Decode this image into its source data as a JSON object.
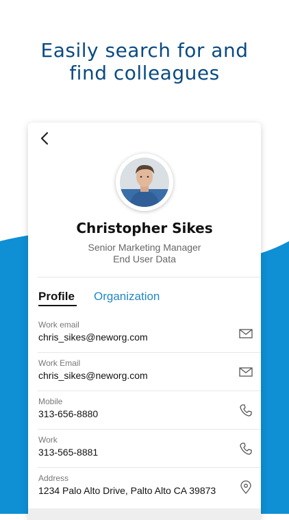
{
  "headline": {
    "line1": "Easily search for and",
    "line2": "find colleagues"
  },
  "colors": {
    "headline": "#0b4a82",
    "wave": "#0f8fd4",
    "accent": "#2187c4"
  },
  "profile": {
    "name": "Christopher Sikes",
    "title": "Senior Marketing Manager",
    "department": "End User Data"
  },
  "tabs": [
    {
      "label": "Profile",
      "active": true
    },
    {
      "label": "Organization",
      "active": false
    }
  ],
  "fields": [
    {
      "label": "Work email",
      "value": "chris_sikes@neworg.com",
      "icon": "mail-icon"
    },
    {
      "label": "Work Email",
      "value": "chris_sikes@neworg.com",
      "icon": "mail-icon"
    },
    {
      "label": "Mobile",
      "value": "313-656-8880",
      "icon": "phone-icon"
    },
    {
      "label": "Work",
      "value": "313-565-8881",
      "icon": "phone-icon"
    },
    {
      "label": "Address",
      "value": "1234 Palo Alto Drive, Palto Alto CA 39873",
      "icon": "location-pin-icon"
    }
  ]
}
